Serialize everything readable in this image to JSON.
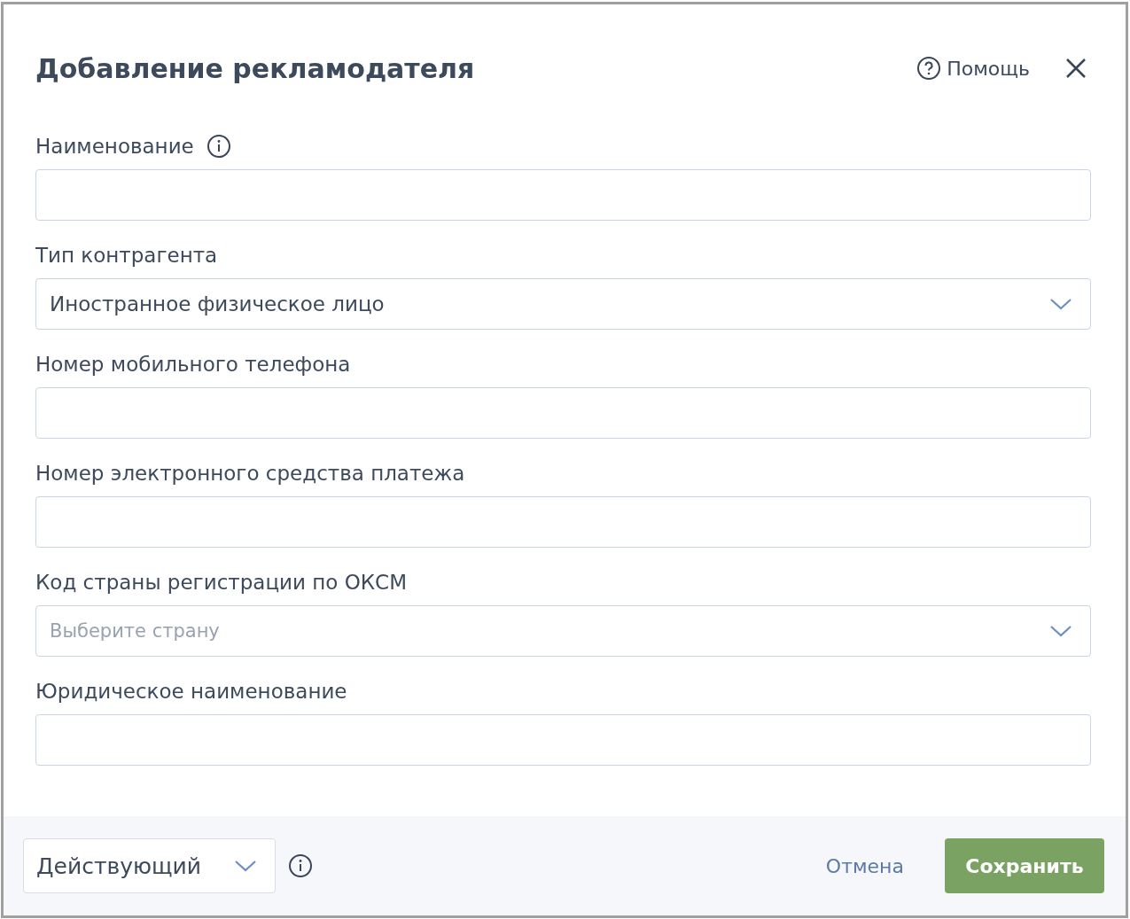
{
  "dialog": {
    "title": "Добавление рекламодателя",
    "help_label": "Помощь"
  },
  "fields": [
    {
      "label": {
        "kind": "with_info",
        "text": "Наименование"
      },
      "kind": "text"
    },
    {
      "label": {
        "kind": "plain",
        "text": "Тип контрагента"
      },
      "kind": "select",
      "value": "Иностранное физическое лицо"
    },
    {
      "label": {
        "kind": "plain",
        "text": "Номер мобильного телефона"
      },
      "kind": "text"
    },
    {
      "label": {
        "kind": "plain",
        "text": "Номер электронного средства платежа"
      },
      "kind": "text"
    },
    {
      "label": {
        "kind": "plain",
        "text": "Код страны регистрации по ОКСМ"
      },
      "kind": "select",
      "placeholder": "Выберите страну"
    },
    {
      "label": {
        "kind": "plain",
        "text": "Юридическое наименование"
      },
      "kind": "text"
    }
  ],
  "footer": {
    "status": "Действующий",
    "cancel": "Отмена",
    "save": "Сохранить"
  }
}
